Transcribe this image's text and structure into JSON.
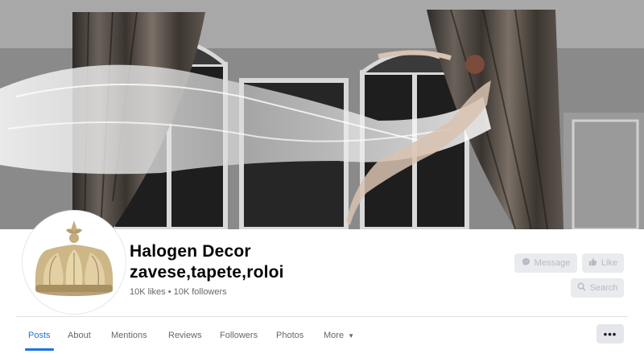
{
  "page": {
    "name": "Halogen Decor zavese,tapete,roloi",
    "likes": "10K likes",
    "separator": "•",
    "followers": "10K followers"
  },
  "actions": {
    "message_label": "Message",
    "like_label": "Like",
    "search_label": "Search"
  },
  "tabs": [
    {
      "label": "Posts",
      "active": true
    },
    {
      "label": "About"
    },
    {
      "label": "Mentions"
    },
    {
      "label": "Reviews"
    },
    {
      "label": "Followers"
    },
    {
      "label": "Photos"
    },
    {
      "label": "More"
    }
  ],
  "more_button_label": "•••",
  "icons": {
    "message": "messenger-icon",
    "like": "thumbs-up-icon",
    "search": "search-icon",
    "more_caret": "caret-down-icon"
  },
  "colors": {
    "accent": "#1b74e4",
    "text": "#050505",
    "secondary_text": "#65676b",
    "button_bg": "#e9ebee"
  }
}
